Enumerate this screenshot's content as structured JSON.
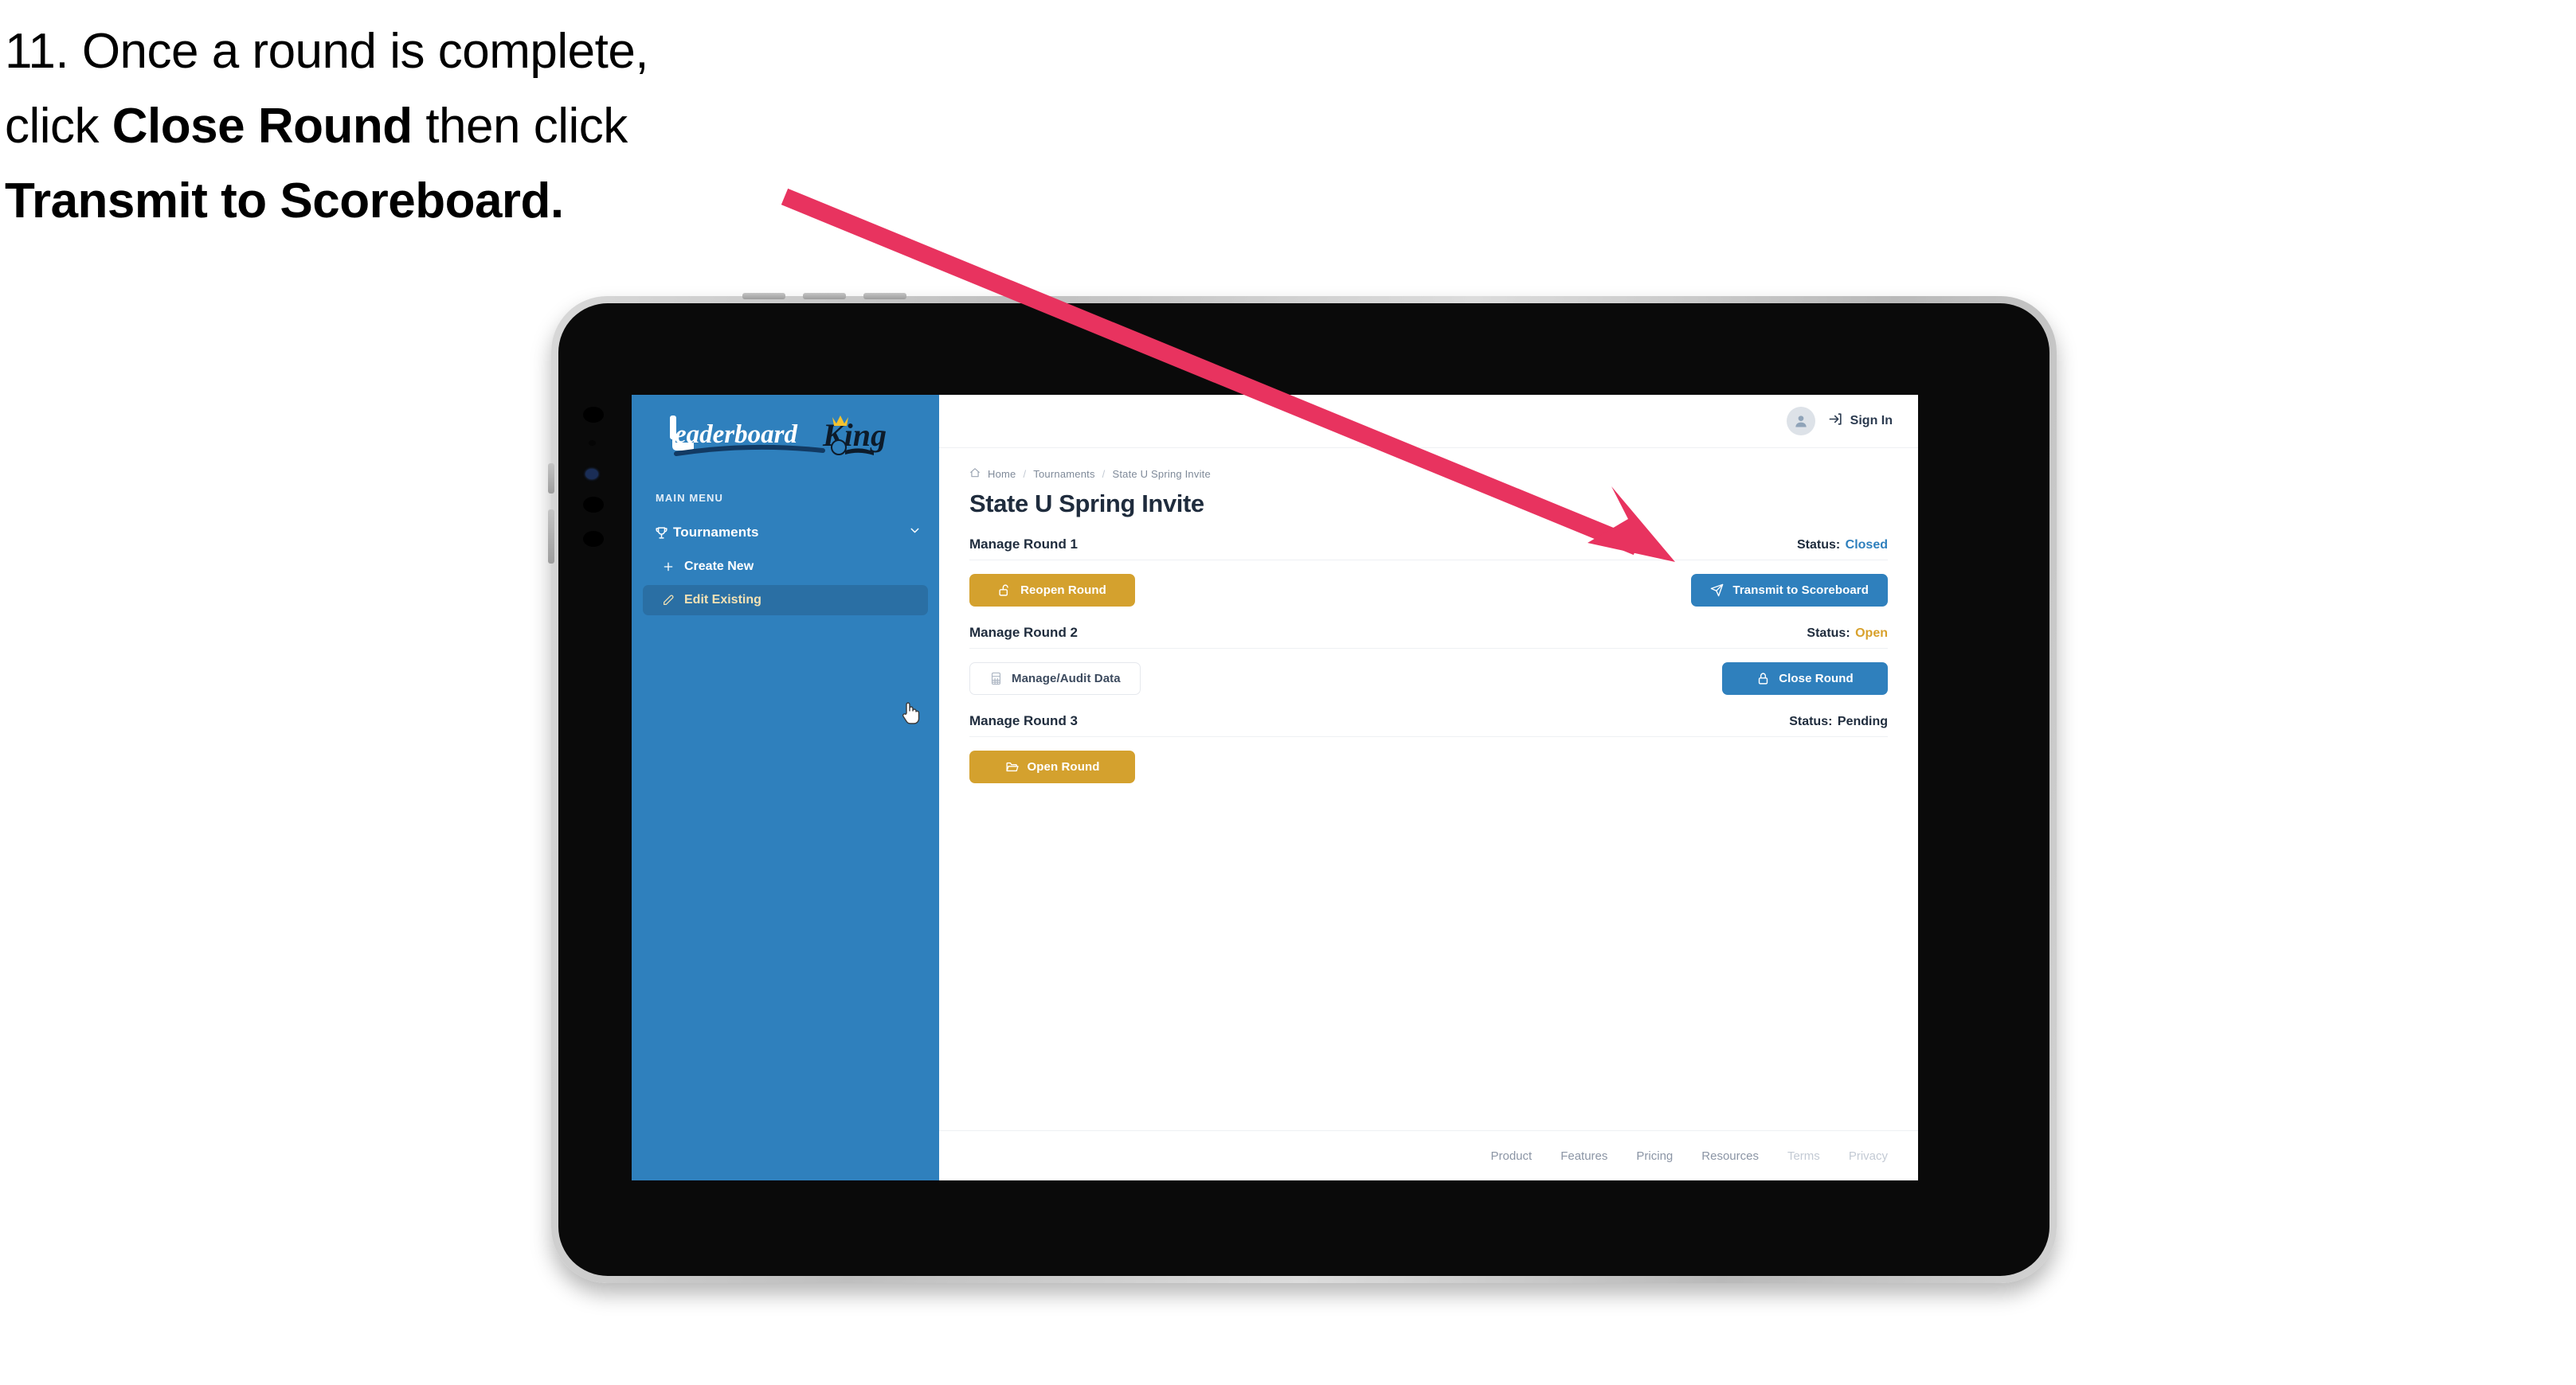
{
  "caption": {
    "line1_plain": "11. Once a round is complete,",
    "line2_pre": "click ",
    "line2_bold": "Close Round",
    "line2_post": " then click",
    "line3_bold": "Transmit to Scoreboard."
  },
  "annotation": {
    "arrow_color": "#e8335f",
    "arrow_start": "985,247",
    "arrow_end": "2100,705"
  },
  "colors": {
    "sidebar_blue": "#2f80bd",
    "brand_blue": "#2f80bd",
    "gold": "#d4a12e",
    "status_open_gold": "#d8a12c",
    "text_dark": "#1f2c3d",
    "muted": "#8d97a6"
  },
  "sidebar": {
    "logo_word1": "Leaderboard",
    "logo_word2": "King",
    "section_label": "MAIN MENU",
    "nav": [
      {
        "label": "Tournaments",
        "icon": "trophy-icon",
        "chevron": "chevron-down-icon",
        "expanded": true
      }
    ],
    "subnav": [
      {
        "label": "Create New",
        "icon": "plus-icon",
        "active": false
      },
      {
        "label": "Edit Existing",
        "icon": "edit-pencil-icon",
        "active": true
      }
    ]
  },
  "topbar": {
    "avatar_icon": "user-avatar-icon",
    "signin_icon": "sign-in-arrow-icon",
    "signin_label": "Sign In"
  },
  "breadcrumb": {
    "home_icon": "home-icon",
    "items": [
      "Home",
      "Tournaments",
      "State U Spring Invite"
    ],
    "separator": "/"
  },
  "page": {
    "title": "State U Spring Invite"
  },
  "rounds": [
    {
      "title": "Manage Round 1",
      "status_label": "Status:",
      "status_value": "Closed",
      "status_class": "closed",
      "left_button": {
        "label": "Reopen Round",
        "icon": "unlock-icon",
        "style": "gold"
      },
      "right_button": {
        "label": "Transmit to Scoreboard",
        "icon": "paper-plane-icon",
        "style": "blue"
      }
    },
    {
      "title": "Manage Round 2",
      "status_label": "Status:",
      "status_value": "Open",
      "status_class": "open",
      "left_button": {
        "label": "Manage/Audit Data",
        "icon": "calculator-icon",
        "style": "ghost"
      },
      "right_button": {
        "label": "Close Round",
        "icon": "lock-icon",
        "style": "blue"
      }
    },
    {
      "title": "Manage Round 3",
      "status_label": "Status:",
      "status_value": "Pending",
      "status_class": "pending",
      "left_button": {
        "label": "Open Round",
        "icon": "folder-open-icon",
        "style": "gold"
      },
      "right_button": null
    }
  ],
  "footer": {
    "links": [
      {
        "label": "Product",
        "muted": false
      },
      {
        "label": "Features",
        "muted": false
      },
      {
        "label": "Pricing",
        "muted": false
      },
      {
        "label": "Resources",
        "muted": false
      },
      {
        "label": "Terms",
        "muted": true
      },
      {
        "label": "Privacy",
        "muted": true
      }
    ]
  },
  "cursor": {
    "type": "pointing-hand-cursor"
  }
}
